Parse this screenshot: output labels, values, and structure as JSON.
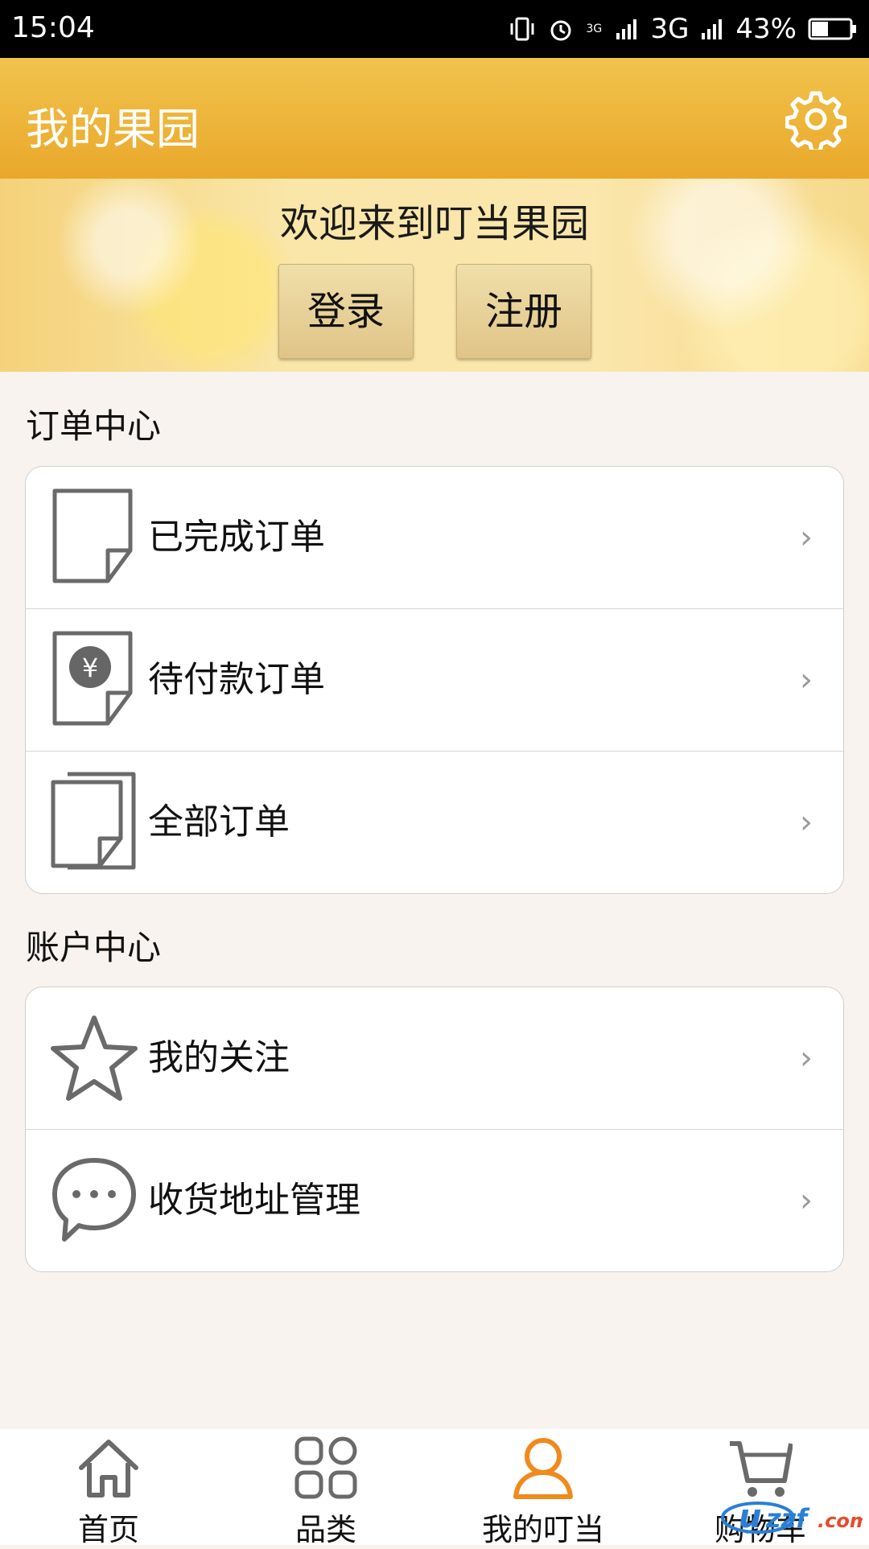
{
  "status": {
    "time": "15:04",
    "network_small": "3G",
    "network": "3G",
    "battery": "43%"
  },
  "appbar": {
    "title": "我的果园",
    "settings_icon": "gear-icon"
  },
  "banner": {
    "welcome": "欢迎来到叮当果园",
    "login": "登录",
    "register": "注册"
  },
  "orders": {
    "title": "订单中心",
    "items": [
      {
        "label": "已完成订单",
        "icon": "document-icon"
      },
      {
        "label": "待付款订单",
        "icon": "yuan-document-icon"
      },
      {
        "label": "全部订单",
        "icon": "documents-icon"
      }
    ]
  },
  "account": {
    "title": "账户中心",
    "items": [
      {
        "label": "我的关注",
        "icon": "star-icon"
      },
      {
        "label": "收货地址管理",
        "icon": "chat-bubble-icon"
      }
    ]
  },
  "chevron": "›",
  "nav": {
    "items": [
      {
        "label": "首页",
        "icon": "home-icon"
      },
      {
        "label": "品类",
        "icon": "grid-icon"
      },
      {
        "label": "我的叮当",
        "icon": "user-icon",
        "active": true
      },
      {
        "label": "购物车",
        "icon": "cart-icon"
      }
    ],
    "active_color": "#f08a1c"
  },
  "colors": {
    "appbar": "#eab332",
    "background": "#f8f3ef"
  }
}
